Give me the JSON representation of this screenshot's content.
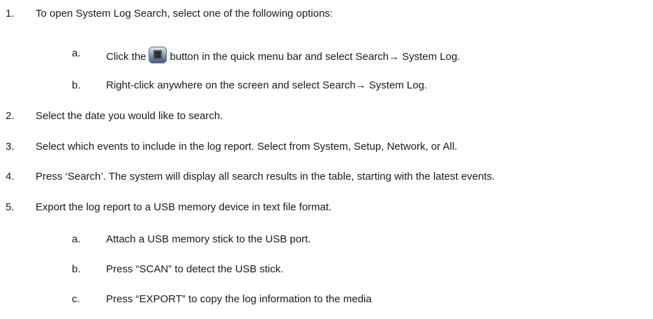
{
  "steps": [
    {
      "num": "1.",
      "text": "To open System Log Search, select one of the following options:"
    },
    {
      "num": "2.",
      "text": "Select the date you would like to search."
    },
    {
      "num": "3.",
      "text": "Select which events to include in the log report. Select from System, Setup, Network, or All."
    },
    {
      "num": "4.",
      "text": "Press ‘Search’. The system will display all search results in the table, starting with the latest events."
    },
    {
      "num": "5.",
      "text": "Export the log report to a USB memory device in text file format."
    }
  ],
  "step1_subs": [
    {
      "letter": "a.",
      "before": "Click the",
      "after": "button in the quick menu bar and select Search→ System Log.",
      "icon": "quick-menu-button-icon"
    },
    {
      "letter": "b.",
      "text": "Right-click anywhere on the screen and select Search→ System Log."
    }
  ],
  "step5_subs": [
    {
      "letter": "a.",
      "text": "Attach a USB memory stick to the USB port."
    },
    {
      "letter": "b.",
      "text": "Press “SCAN” to detect the USB stick."
    },
    {
      "letter": "c.",
      "text": "Press “EXPORT” to copy the log information to the media"
    }
  ]
}
